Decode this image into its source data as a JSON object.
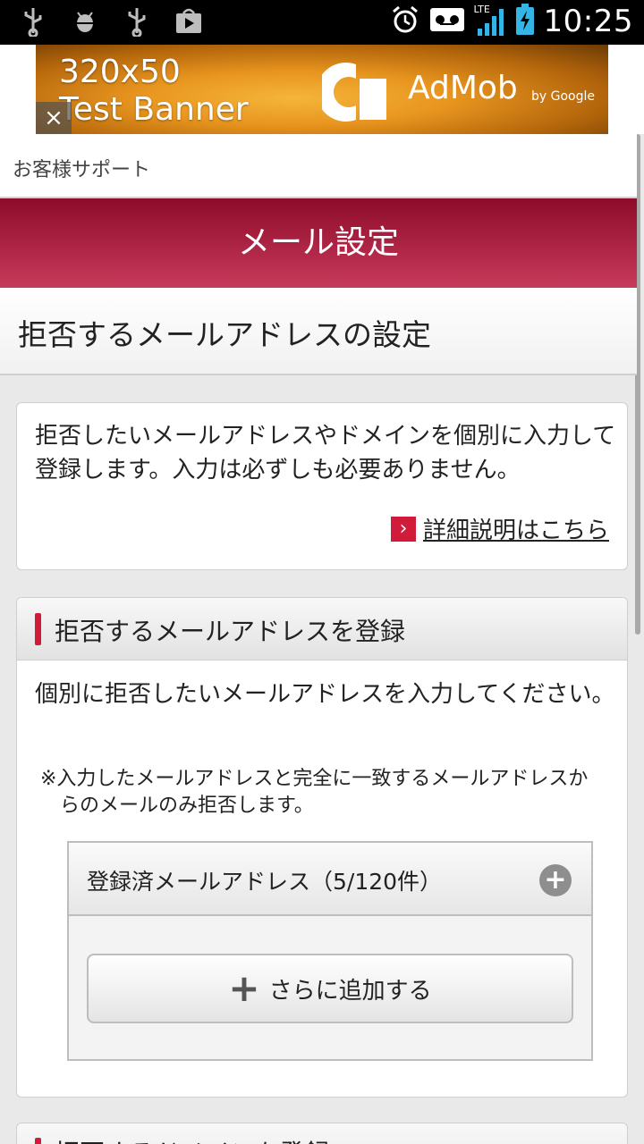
{
  "status_bar": {
    "time": "10:25",
    "network": "LTE",
    "left_icons": [
      "usb-icon",
      "android-debug-icon",
      "usb-icon",
      "play-store-icon"
    ],
    "right_icons": [
      "alarm-icon",
      "voicemail-icon",
      "signal-icon",
      "battery-charging-icon"
    ]
  },
  "ad": {
    "line1": "320x50",
    "line2": "Test Banner",
    "brand": "AdMob",
    "by": "by Google",
    "close": "×"
  },
  "breadcrumb": "お客様サポート",
  "header": {
    "title": "メール設定"
  },
  "subtitle": "拒否するメールアドレスの設定",
  "info": {
    "text": "拒否したいメールアドレスやドメインを個別に入力して登録します。入力は必ずしも必要ありません。",
    "link_arrow": "›",
    "link": "詳細説明はこちら"
  },
  "section": {
    "title": "拒否するメールアドレスを登録",
    "description": "個別に拒否したいメールアドレスを入力してください。",
    "note": "※入力したメールアドレスと完全に一致するメールアドレスからのメールのみ拒否します。",
    "registered": {
      "title": "登録済メールアドレス（5/120件）",
      "expand": "+"
    },
    "add_button": {
      "icon": "+",
      "label": "さらに追加する"
    }
  },
  "next_section": {
    "title": "拒否するドメインを登録"
  },
  "colors": {
    "accent": "#d11b3b",
    "header_top": "#8e0b2a",
    "header_bottom": "#c83a5b"
  }
}
